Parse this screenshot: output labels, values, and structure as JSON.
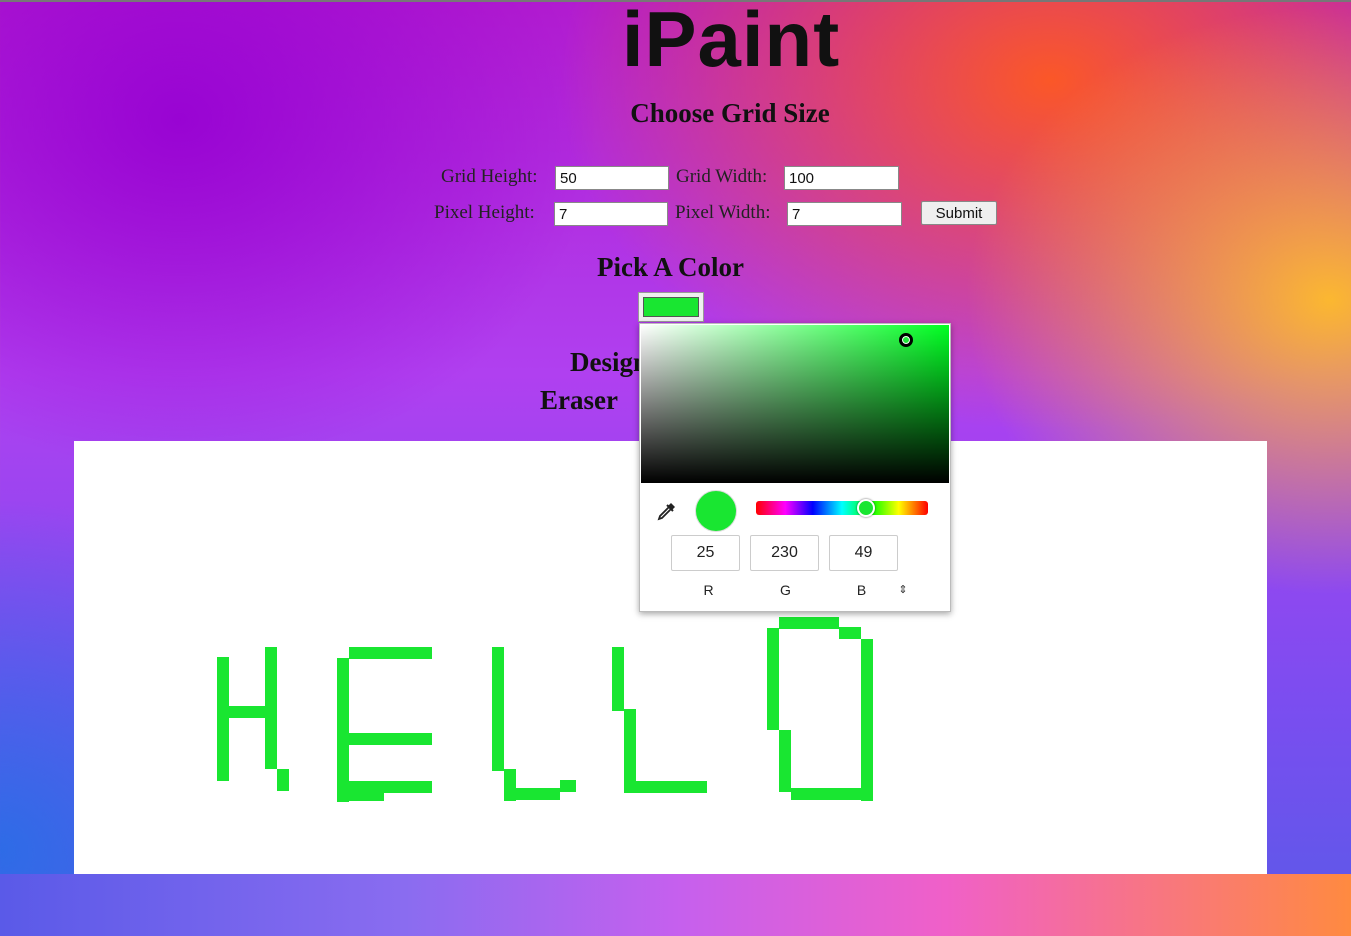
{
  "app": {
    "title": "iPaint"
  },
  "grid_section": {
    "heading": "Choose Grid Size",
    "grid_height_label": "Grid Height:",
    "grid_height_value": "50",
    "grid_width_label": "Grid Width:",
    "grid_width_value": "100",
    "pixel_height_label": "Pixel Height:",
    "pixel_height_value": "7",
    "pixel_width_label": "Pixel Width:",
    "pixel_width_value": "7",
    "submit_label": "Submit"
  },
  "color_section": {
    "heading": "Pick A Color",
    "current_color": "#19e631"
  },
  "design_heading": "Design Canvas",
  "eraser_heading": "Eraser",
  "color_picker": {
    "r": "25",
    "g": "230",
    "b": "49",
    "r_label": "R",
    "g_label": "G",
    "b_label": "B",
    "mode_toggle_icon": "updown-chevron-icon",
    "eyedropper_icon": "eyedropper-icon"
  },
  "canvas": {
    "background": "#ffffff",
    "drawn_text": "HELLO",
    "stroke_color": "#19e631"
  }
}
